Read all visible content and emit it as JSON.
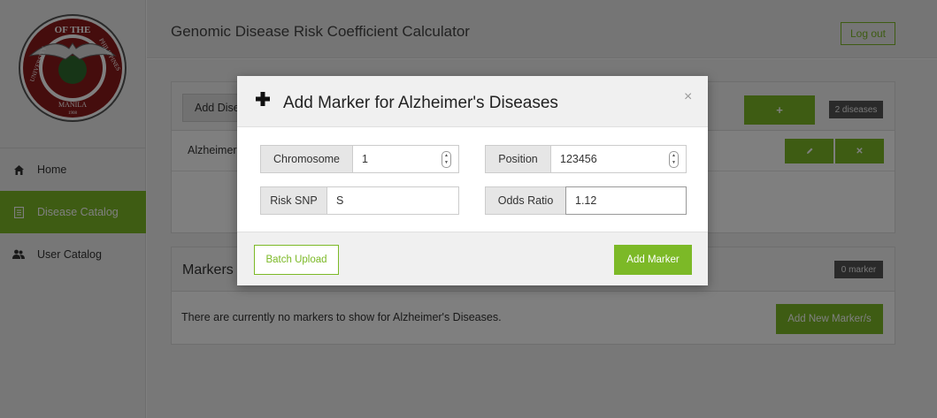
{
  "app": {
    "title": "Genomic Disease Risk Coefficient Calculator",
    "logout_label": "Log out",
    "accent_color": "#7cb927"
  },
  "sidebar": {
    "logo": {
      "top_text": "OF THE",
      "left_text": "UNIVERSITY",
      "right_text": "PHILIPPINES",
      "bottom_text": "MANILA",
      "year": "1908",
      "icon": "university-seal-icon"
    },
    "items": [
      {
        "label": "Home",
        "icon": "home-icon",
        "active": false
      },
      {
        "label": "Disease Catalog",
        "icon": "document-icon",
        "active": true
      },
      {
        "label": "User Catalog",
        "icon": "users-icon",
        "active": false
      }
    ]
  },
  "disease_panel": {
    "add_label": "Add Dise",
    "add_button_icon": "plus-icon",
    "count_badge": "2 diseases",
    "rows": [
      {
        "name": "Alzheimer",
        "edit_icon": "pencil-icon",
        "delete_icon": "close-icon"
      }
    ]
  },
  "markers_panel": {
    "title": "Markers",
    "count_badge": "0 marker",
    "empty_text": "There are currently no markers to show for Alzheimer's Diseases.",
    "add_button_label": "Add New Marker/s"
  },
  "modal": {
    "title": "Add Marker for Alzheimer's Diseases",
    "title_icon": "plus-icon",
    "close_glyph": "×",
    "fields": {
      "chromosome": {
        "label": "Chromosome",
        "value": "1"
      },
      "position": {
        "label": "Position",
        "value": "123456"
      },
      "risk_snp": {
        "label": "Risk SNP",
        "value": "S"
      },
      "odds_ratio": {
        "label": "Odds Ratio",
        "value": "1.12"
      }
    },
    "batch_upload_label": "Batch Upload",
    "add_marker_label": "Add Marker"
  }
}
